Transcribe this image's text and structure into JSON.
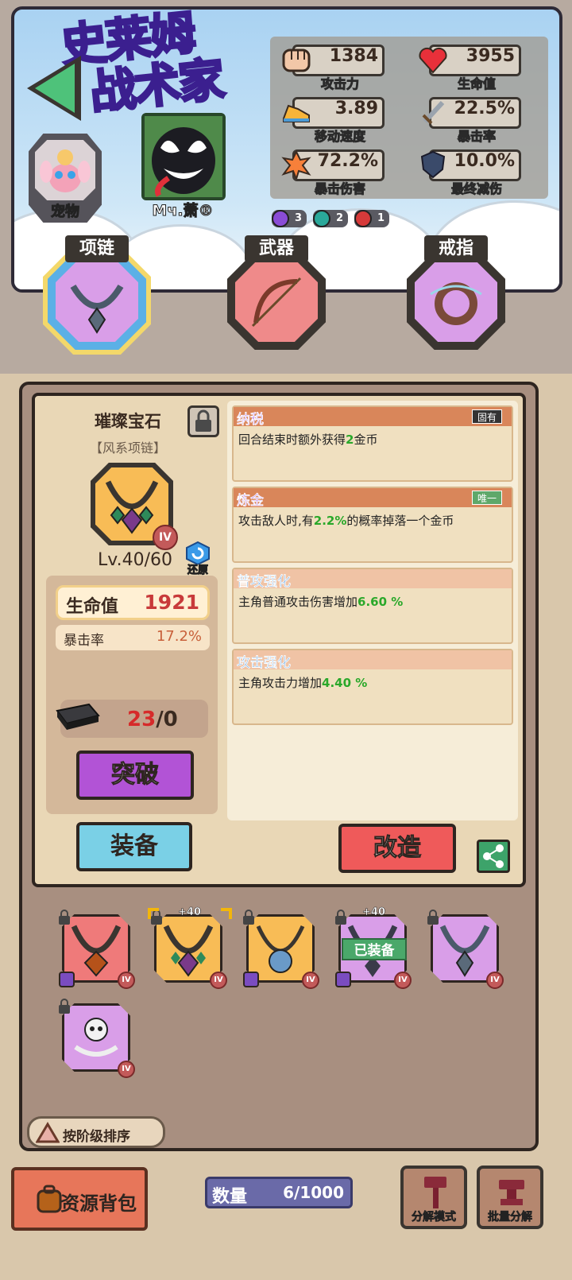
{
  "header": {
    "logo_line1": "史莱姆",
    "logo_line2": "战术家",
    "pet_label": "宠物",
    "player_name": "Mч.萧®"
  },
  "stats": [
    {
      "icon": "fist-icon",
      "value": "1384",
      "label": "攻击力"
    },
    {
      "icon": "heart-icon",
      "value": "3955",
      "label": "生命值"
    },
    {
      "icon": "shoe-icon",
      "value": "3.89",
      "label": "移动速度"
    },
    {
      "icon": "sword-icon",
      "value": "22.5%",
      "label": "暴击率"
    },
    {
      "icon": "explosion-icon",
      "value": "72.2%",
      "label": "暴击伤害"
    },
    {
      "icon": "shield-icon",
      "value": "10.0%",
      "label": "最终减伤"
    }
  ],
  "elements": [
    {
      "icon": "arcane-icon",
      "count": "3",
      "color": "#8a4cd6"
    },
    {
      "icon": "wind-icon",
      "count": "2",
      "color": "#2aa89a"
    },
    {
      "icon": "fire-icon",
      "count": "1",
      "color": "#d63a3a"
    }
  ],
  "slots": [
    {
      "label": "项链",
      "color": "#d99ee8",
      "active": true
    },
    {
      "label": "武器",
      "color": "#ef8a8a",
      "active": false
    },
    {
      "label": "戒指",
      "color": "#d99ee8",
      "active": false
    }
  ],
  "item": {
    "name": "璀璨宝石",
    "type": "【风系项链】",
    "tier": "IV",
    "level": "Lv.40/60",
    "restore_label": "还原",
    "main_stat_label": "生命值",
    "main_stat_value": "1921",
    "sub_stat_label": "暴击率",
    "sub_stat_value": "17.2%",
    "material_have": "23",
    "material_sep": "/0",
    "break_label": "突破",
    "equip_label": "装备",
    "modify_label": "改造"
  },
  "affixes": [
    {
      "title": "纳税",
      "badge": "固有",
      "desc_pre": "回合结束时额外获得",
      "desc_val": "2",
      "desc_post": "金币"
    },
    {
      "title": "炼金",
      "badge": "唯一",
      "desc_pre": "攻击敌人时,有",
      "desc_val": "2.2%",
      "desc_post": "的概率掉落一个金币"
    },
    {
      "title": "普攻强化",
      "badge": "",
      "desc_pre": "主角普通攻击伤害增加",
      "desc_val": "6.60 %",
      "desc_post": ""
    },
    {
      "title": "攻击强化",
      "badge": "",
      "desc_pre": "主角攻击力增加",
      "desc_val": "4.40 %",
      "desc_post": ""
    }
  ],
  "inventory": [
    {
      "bg": "#ef7a7a",
      "gem": "#b5521a",
      "tier": "IV",
      "plus": "",
      "equipped": false,
      "element": true
    },
    {
      "bg": "#f8bc56",
      "gem": "#2e8a5a",
      "tier": "IV",
      "plus": "+40",
      "equipped": false,
      "element": false
    },
    {
      "bg": "#f8bc56",
      "gem": "#6a9ac8",
      "tier": "IV",
      "plus": "",
      "equipped": false,
      "element": true
    },
    {
      "bg": "#d99ee8",
      "gem": "#3a3a4a",
      "tier": "IV",
      "plus": "+40",
      "equipped": true,
      "element": true
    },
    {
      "bg": "#d99ee8",
      "gem": "#5a6a7a",
      "tier": "IV",
      "plus": "",
      "equipped": false,
      "element": false
    },
    {
      "bg": "#d99ee8",
      "gem": "#eeeeee",
      "tier": "IV",
      "plus": "",
      "equipped": false,
      "element": false
    }
  ],
  "equipped_label": "已装备",
  "sort_label": "按阶级排序",
  "footer": {
    "bag_label": "资源背包",
    "count_label": "数量",
    "count_value": "6/1000",
    "decompose_mode": "分解模式",
    "batch_decompose": "批量分解"
  }
}
